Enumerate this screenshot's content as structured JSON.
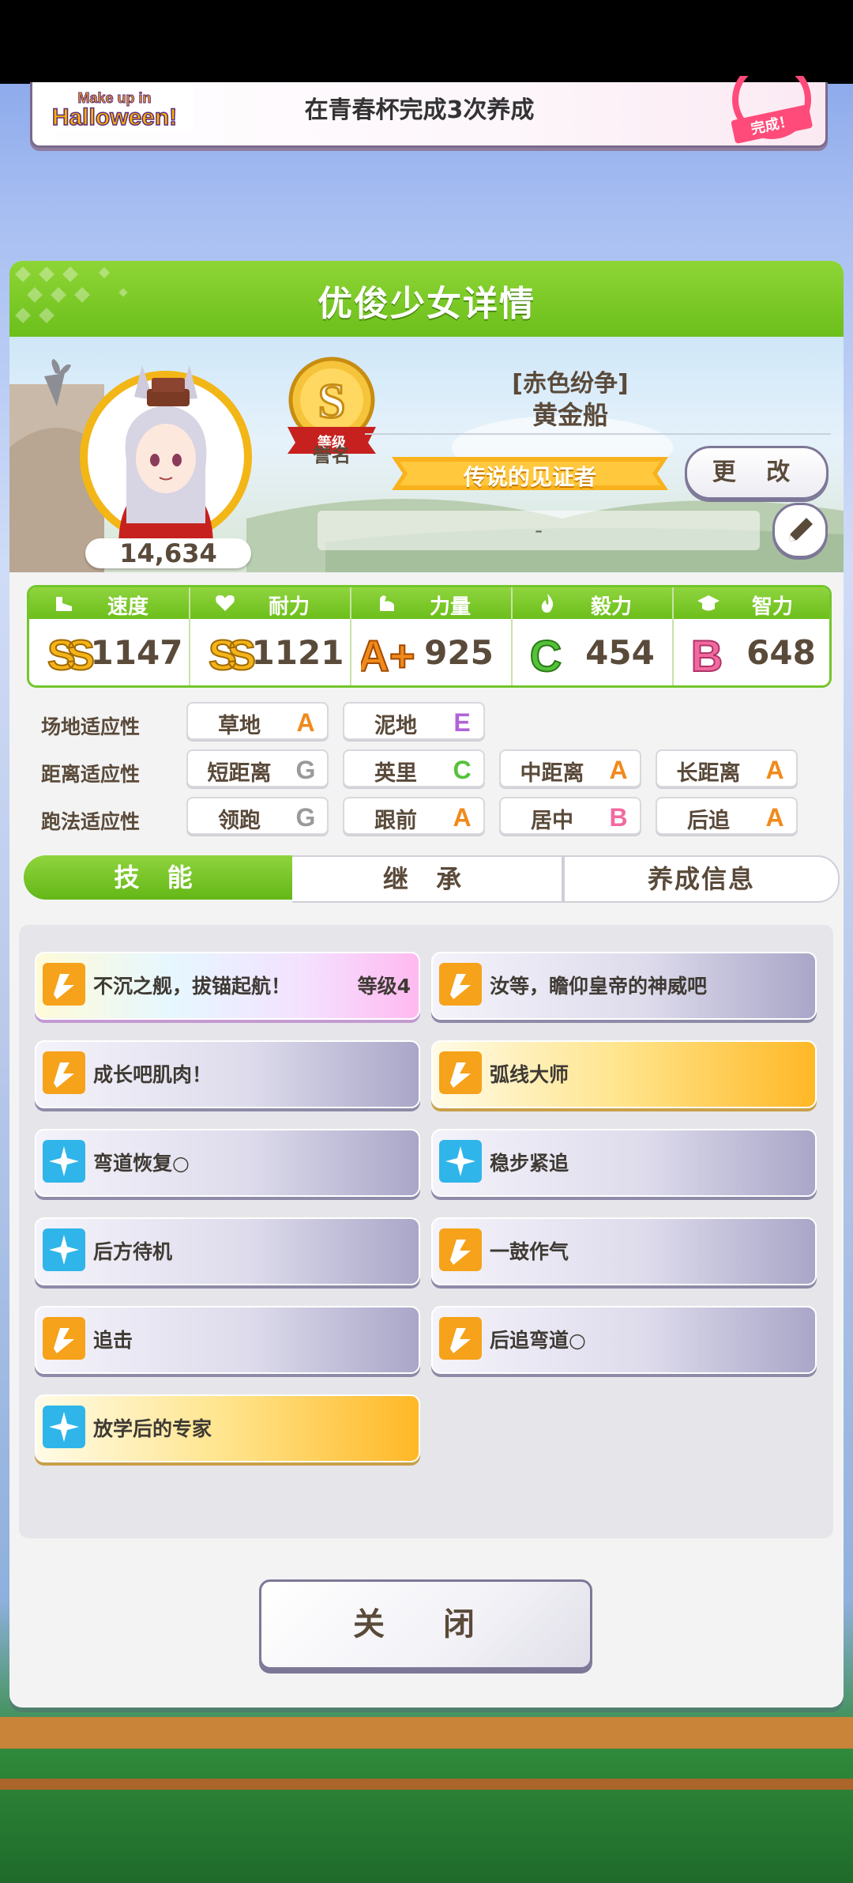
{
  "banner": {
    "logo_text": "Make up in Halloween!",
    "mission_text": "在青春杯完成3次养成",
    "stamp_text": "完成！"
  },
  "panel": {
    "title": "优俊少女详情"
  },
  "character": {
    "fans": "14,634",
    "rank_grade": "S",
    "rank_ribbon": "等级",
    "rank_label": "誉名",
    "outfit": "[赤色纷争]",
    "name": "黄金船",
    "title": "传说的见证者",
    "change_label": "更 改",
    "comment": "-"
  },
  "stats": [
    {
      "label": "速度",
      "grade": "SS",
      "value": "1147",
      "icon": "shoe-icon"
    },
    {
      "label": "耐力",
      "grade": "SS",
      "value": "1121",
      "icon": "heart-icon"
    },
    {
      "label": "力量",
      "grade": "A+",
      "value": "925",
      "icon": "muscle-icon"
    },
    {
      "label": "毅力",
      "grade": "C",
      "value": "454",
      "icon": "flame-icon"
    },
    {
      "label": "智力",
      "grade": "B",
      "value": "648",
      "icon": "graduation-cap-icon"
    }
  ],
  "aptitude": {
    "track": {
      "label": "场地适应性",
      "items": [
        {
          "name": "草地",
          "grade": "A"
        },
        {
          "name": "泥地",
          "grade": "E"
        }
      ]
    },
    "distance": {
      "label": "距离适应性",
      "items": [
        {
          "name": "短距离",
          "grade": "G"
        },
        {
          "name": "英里",
          "grade": "C"
        },
        {
          "name": "中距离",
          "grade": "A"
        },
        {
          "name": "长距离",
          "grade": "A"
        }
      ]
    },
    "style": {
      "label": "跑法适应性",
      "items": [
        {
          "name": "领跑",
          "grade": "G"
        },
        {
          "name": "跟前",
          "grade": "A"
        },
        {
          "name": "居中",
          "grade": "B"
        },
        {
          "name": "后追",
          "grade": "A"
        }
      ]
    }
  },
  "tabs": [
    "技 能",
    "继 承",
    "养成信息"
  ],
  "skills": [
    {
      "name": "不沉之舰，拔锚起航！",
      "level": "等级4",
      "style": "rainbow",
      "icon": "speed-skill-icon"
    },
    {
      "name": "汝等，瞻仰皇帝的神威吧",
      "style": "silver",
      "icon": "speed-skill-icon"
    },
    {
      "name": "成长吧肌肉！",
      "style": "silver",
      "icon": "speed-skill-icon"
    },
    {
      "name": "弧线大师",
      "style": "gold",
      "icon": "speed-skill-icon"
    },
    {
      "name": "弯道恢复○",
      "style": "silver",
      "icon": "recovery-skill-icon"
    },
    {
      "name": "稳步紧追",
      "style": "silver",
      "icon": "recovery-skill-icon"
    },
    {
      "name": "后方待机",
      "style": "silver",
      "icon": "recovery-skill-icon"
    },
    {
      "name": "一鼓作气",
      "style": "silver",
      "icon": "speed-skill-icon"
    },
    {
      "name": "追击",
      "style": "silver",
      "icon": "speed-skill-icon"
    },
    {
      "name": "后追弯道○",
      "style": "silver",
      "icon": "speed-skill-icon"
    },
    {
      "name": "放学后的专家",
      "style": "gold",
      "icon": "recovery-skill-icon"
    }
  ],
  "close_label": "关 闭",
  "colors": {
    "accent_green": "#6cbf1b",
    "text_brown": "#5a4a3a",
    "grade_A": "#f08a1c",
    "grade_B": "#f06aa0",
    "grade_C": "#54c23a",
    "grade_E": "#b064d8",
    "grade_G": "#9a9a9a"
  }
}
